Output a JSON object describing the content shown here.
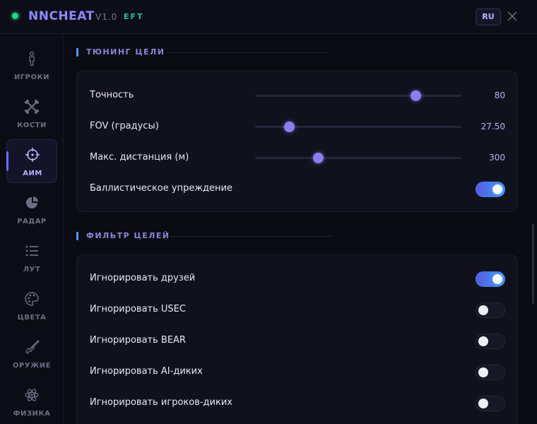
{
  "app": {
    "title": "NNCHEAT",
    "version": "V1.0",
    "game": "EFT",
    "lang_button": "RU",
    "status_color": "#22d68a",
    "accent_color": "#8c88ff"
  },
  "sidebar": {
    "items": [
      {
        "label": "ИГРОКИ",
        "icon": "person-icon",
        "active": false
      },
      {
        "label": "КОСТИ",
        "icon": "bones-icon",
        "active": false
      },
      {
        "label": "АИМ",
        "icon": "crosshair-icon",
        "active": true
      },
      {
        "label": "РАДАР",
        "icon": "radar-icon",
        "active": false
      },
      {
        "label": "ЛУТ",
        "icon": "list-icon",
        "active": false
      },
      {
        "label": "ЦВЕТА",
        "icon": "palette-icon",
        "active": false
      },
      {
        "label": "ОРУЖИЕ",
        "icon": "rifle-icon",
        "active": false
      },
      {
        "label": "ФИЗИКА",
        "icon": "atom-icon",
        "active": false
      }
    ]
  },
  "tuning": {
    "title": "ТЮНИНГ ЦЕЛИ",
    "sliders": [
      {
        "label": "Точность",
        "value": "80",
        "fraction": 0.78
      },
      {
        "label": "FOV (градусы)",
        "value": "27.50",
        "fraction": 0.165
      },
      {
        "label": "Макс. дистанция (м)",
        "value": "300",
        "fraction": 0.305
      }
    ],
    "toggles": [
      {
        "label": "Баллистическое упреждение",
        "on": true
      }
    ]
  },
  "filter": {
    "title": "ФИЛЬТР ЦЕЛЕЙ",
    "toggles": [
      {
        "label": "Игнорировать друзей",
        "on": true
      },
      {
        "label": "Игнорировать USEC",
        "on": false
      },
      {
        "label": "Игнорировать BEAR",
        "on": false
      },
      {
        "label": "Игнорировать AI-диких",
        "on": false
      },
      {
        "label": "Игнорировать игроков-диких",
        "on": false
      }
    ]
  }
}
